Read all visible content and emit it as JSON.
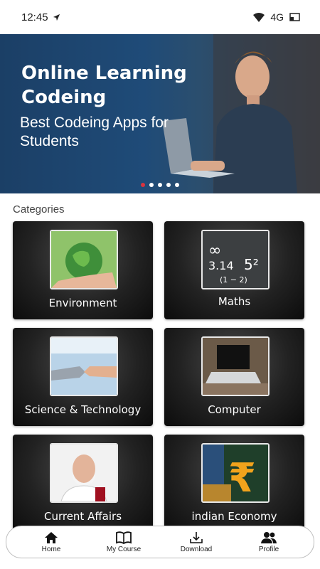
{
  "status_bar": {
    "time": "12:45",
    "network": "4G"
  },
  "banner": {
    "title": "Online Learning Codeing",
    "subtitle": "Best Codeing Apps for Students",
    "slide_count": 5,
    "active_slide": 1
  },
  "categories": {
    "heading": "Categories",
    "items": [
      {
        "label": "Environment"
      },
      {
        "label": "Maths"
      },
      {
        "label": "Science & Technology"
      },
      {
        "label": "Computer"
      },
      {
        "label": "Current Affairs"
      },
      {
        "label": "indian Economy"
      }
    ]
  },
  "bottom_nav": {
    "items": [
      {
        "label": "Home",
        "icon": "home-icon"
      },
      {
        "label": "My Course",
        "icon": "book-icon"
      },
      {
        "label": "Download",
        "icon": "download-icon"
      },
      {
        "label": "Profile",
        "icon": "profile-icon"
      }
    ]
  },
  "colors": {
    "banner_bg": "#1f4b78",
    "active_dot": "#d9333f",
    "card_bg": "#222222"
  }
}
